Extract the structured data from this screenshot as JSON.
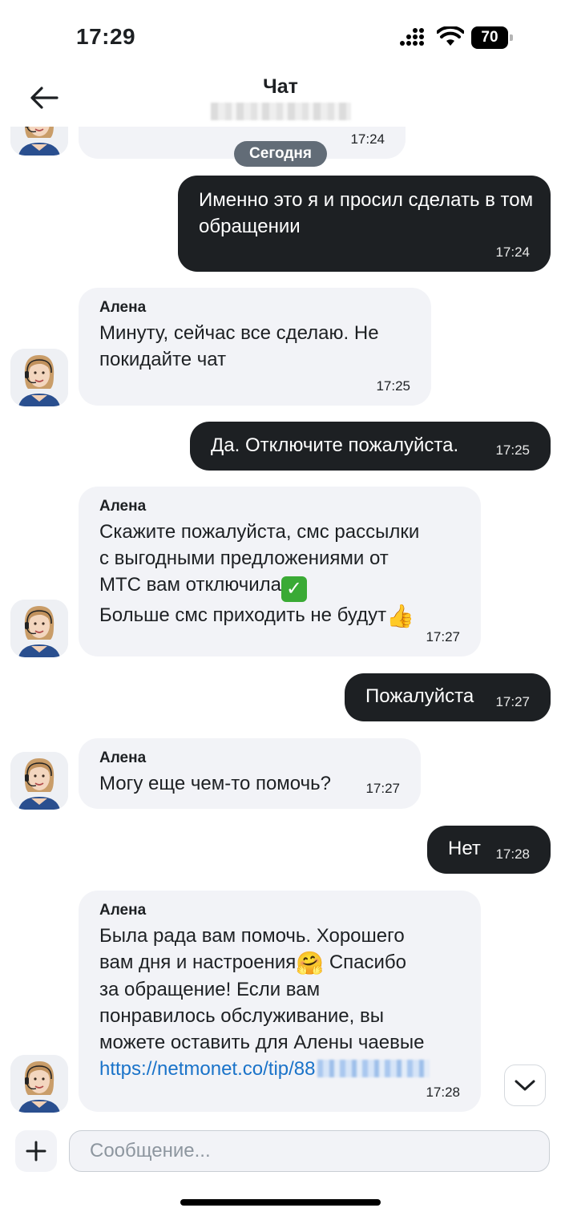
{
  "status_bar": {
    "time": "17:29",
    "battery": "70"
  },
  "header": {
    "title": "Чат",
    "subtitle_hidden": ""
  },
  "date_divider": "Сегодня",
  "messages": [
    {
      "time": "17:24"
    },
    {
      "text": "Именно это я и просил сделать в том обращении",
      "time": "17:24"
    },
    {
      "author": "Алена",
      "text": "Минуту, сейчас все сделаю. Не покидайте чат",
      "time": "17:25"
    },
    {
      "text": "Да. Отключите пожалуйста.",
      "time": "17:25"
    },
    {
      "author": "Алена",
      "line1": "Скажите пожалуйста, смс рассылки",
      "line2": "с выгодными предложениями от",
      "line3": "МТС вам отключила",
      "line4": "Больше смс приходить не будут",
      "time": "17:27"
    },
    {
      "text": "Пожалуйста",
      "time": "17:27"
    },
    {
      "author": "Алена",
      "text": "Могу еще чем-то помочь?",
      "time": "17:27"
    },
    {
      "text": "Нет",
      "time": "17:28"
    },
    {
      "author": "Алена",
      "line1": "Была рада вам помочь. Хорошего",
      "line2a": "вам дня и настроения",
      "line2b": " Спасибо",
      "line3": "за обращение! Если вам",
      "line4": "понравилось обслуживание, вы",
      "line5": "можете оставить для Алены чаевые",
      "link": "https://netmonet.co/tip/88",
      "time": "17:28"
    }
  ],
  "composer": {
    "placeholder": "Сообщение..."
  },
  "icons": {
    "back": "arrow-left-icon",
    "plus": "plus-icon",
    "scroll": "chevron-down-icon",
    "emoji_check": "check-mark-button-emoji",
    "emoji_thumbs": "thumbs-up-emoji",
    "emoji_hug": "hugging-face-emoji"
  },
  "colors": {
    "outgoing_bubble": "#1d2023",
    "incoming_bubble": "#f2f3f7",
    "link": "#1a73c9",
    "date_pill": "#626c77"
  }
}
